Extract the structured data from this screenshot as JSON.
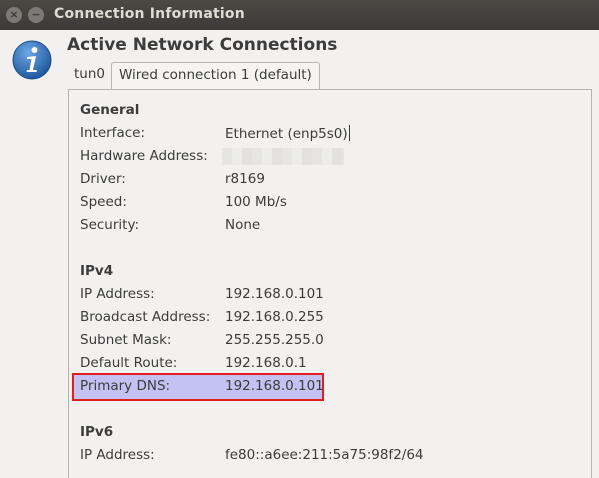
{
  "window": {
    "title": "Connection Information",
    "close_glyph": "×",
    "minimize_glyph": "−"
  },
  "header": {
    "title": "Active Network Connections",
    "icon": "info-icon"
  },
  "tabs": [
    {
      "label": "tun0",
      "selected": false
    },
    {
      "label": "Wired connection 1 (default)",
      "selected": true
    }
  ],
  "general": {
    "title": "General",
    "rows": [
      {
        "label": "Interface:",
        "value": "Ethernet (enp5s0)"
      },
      {
        "label": "Hardware Address:",
        "value": ""
      },
      {
        "label": "Driver:",
        "value": "r8169"
      },
      {
        "label": "Speed:",
        "value": "100 Mb/s"
      },
      {
        "label": "Security:",
        "value": "None"
      }
    ]
  },
  "ipv4": {
    "title": "IPv4",
    "rows": [
      {
        "label": "IP Address:",
        "value": "192.168.0.101"
      },
      {
        "label": "Broadcast Address:",
        "value": "192.168.0.255"
      },
      {
        "label": "Subnet Mask:",
        "value": "255.255.255.0"
      },
      {
        "label": "Default Route:",
        "value": "192.168.0.1"
      },
      {
        "label": "Primary DNS:",
        "value": "192.168.0.101"
      }
    ]
  },
  "ipv6": {
    "title": "IPv6",
    "rows": [
      {
        "label": "IP Address:",
        "value": "fe80::a6ee:211:5a75:98f2/64"
      }
    ]
  },
  "colors": {
    "titlebar": "#3c3b37",
    "highlight_fill": "#c3c2f2",
    "highlight_border": "#e11d1d",
    "info_icon": "#2a6bb5"
  }
}
